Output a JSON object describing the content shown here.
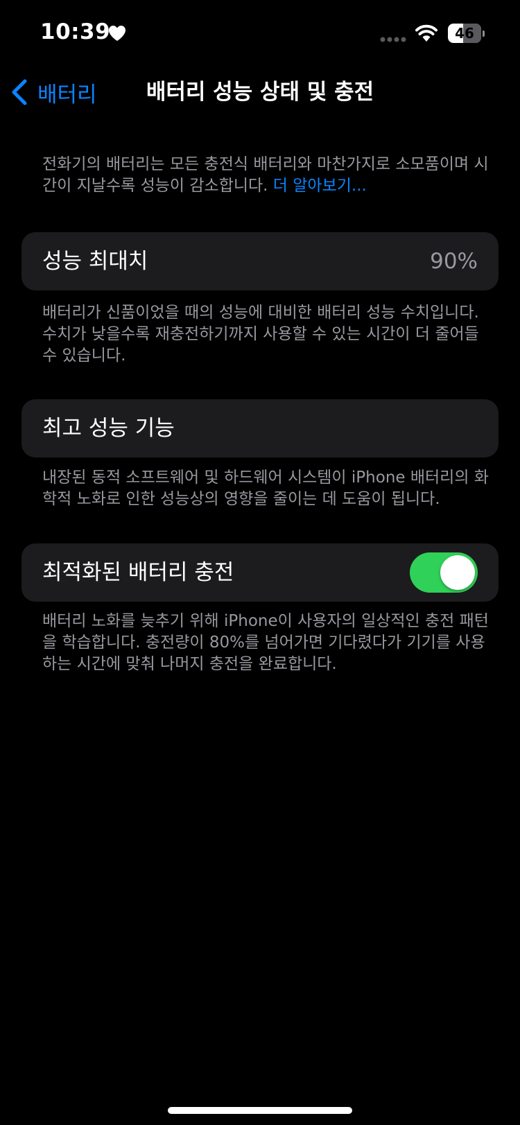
{
  "status_bar": {
    "time": "10:39",
    "battery_level": "46",
    "battery_fraction": 0.46,
    "heart_icon": "heart-icon",
    "wifi_icon": "wifi-icon",
    "signal_icon": "signal-dots-icon"
  },
  "nav": {
    "back_label": "배터리",
    "back_icon": "chevron-left-icon",
    "title": "배터리 성능 상태 및 충전"
  },
  "intro": {
    "text": "전화기의 배터리는 모든 충전식 배터리와 마찬가지로 소모품이며 시간이 지날수록 성능이 감소합니다. ",
    "link": "더 알아보기..."
  },
  "maximum_capacity": {
    "label": "성능 최대치",
    "value": "90%",
    "footer": "배터리가 신품이었을 때의 성능에 대비한 배터리 성능 수치입니다. 수치가 낮을수록 재충전하기까지 사용할 수 있는 시간이 더 줄어들 수 있습니다."
  },
  "peak_performance": {
    "label": "최고 성능 기능",
    "footer": "내장된 동적 소프트웨어 및 하드웨어 시스템이 iPhone 배터리의 화학적 노화로 인한 성능상의 영향을 줄이는 데 도움이 됩니다."
  },
  "optimized_charging": {
    "label": "최적화된 배터리 충전",
    "enabled": true,
    "footer": "배터리 노화를 늦추기 위해 iPhone이 사용자의 일상적인 충전 패턴을 학습합니다. 충전량이 80%를 넘어가면 기다렸다가 기기를 사용하는 시간에 맞춰 나머지 충전을 완료합니다."
  },
  "colors": {
    "background": "#000000",
    "cell_background": "#1c1c1e",
    "accent_blue": "#0a84ff",
    "toggle_on": "#30d158",
    "secondary_text": "#98989f"
  }
}
